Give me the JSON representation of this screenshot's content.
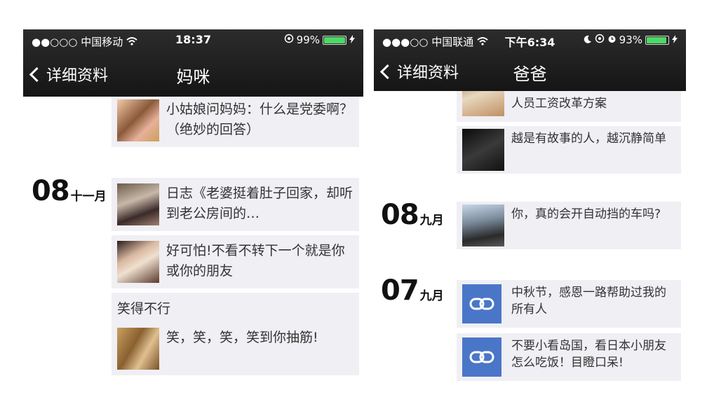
{
  "left": {
    "status": {
      "signal": "●●○○○",
      "carrier": "中国移动",
      "time": "18:37",
      "battery": "99%"
    },
    "nav": {
      "back": "详细资料",
      "title": "妈咪"
    },
    "posts": [
      {
        "text": "小姑娘问妈妈：什么是党委啊？（绝妙的回答）"
      },
      {
        "date_day": "08",
        "date_month": "十一月",
        "text": "日志《老婆挺着肚子回家，却听到老公房间的…"
      },
      {
        "text": "好可怕!不看不转下一个就是你或你的朋友"
      },
      {
        "caption": "笑得不行",
        "text": "笑，笑，笑，笑到你抽筋!"
      }
    ]
  },
  "right": {
    "status": {
      "signal": "●●●○○",
      "carrier": "中国联通",
      "time": "下午6:34",
      "battery": "93%"
    },
    "nav": {
      "back": "详细资料",
      "title": "爸爸"
    },
    "posts": [
      {
        "text": "人员工资改革方案"
      },
      {
        "text": "越是有故事的人，越沉静简单"
      },
      {
        "date_day": "08",
        "date_month": "九月",
        "text": "你，真的会开自动挡的车吗?"
      },
      {
        "date_day": "07",
        "date_month": "九月",
        "text": "中秋节，感恩一路帮助过我的所有人"
      },
      {
        "text": "不要小看岛国，看日本小朋友怎么吃饭！目瞪口呆!"
      }
    ]
  }
}
